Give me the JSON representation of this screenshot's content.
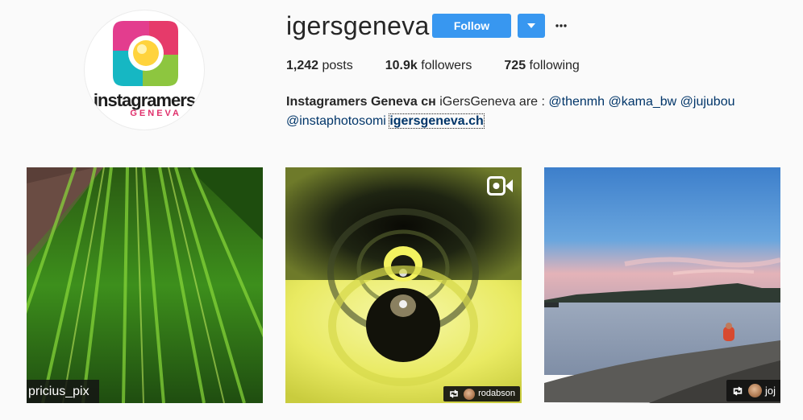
{
  "profile": {
    "username": "igersgeneva",
    "follow_label": "Follow",
    "more_icon": "more-options-icon",
    "logo": {
      "text": "instagramers",
      "subtext": "GENEVA"
    },
    "stats": {
      "posts_count": "1,242",
      "posts_label": "posts",
      "followers_count": "10.9k",
      "followers_label": "followers",
      "following_count": "725",
      "following_label": "following"
    },
    "bio": {
      "name": "Instagramers Geneva ᴄʜ",
      "text": "iGersGeneva are :",
      "mentions": [
        "@thenmh",
        "@kama_bw",
        "@jujubou",
        "@instaphotosomi"
      ],
      "link": "igersgeneva.ch"
    }
  },
  "posts": [
    {
      "caption": "pricius_pix",
      "type": "photo"
    },
    {
      "caption": "rodabson",
      "type": "video",
      "icon": "video-camera-icon",
      "repost_icon": "repost-icon"
    },
    {
      "caption": "joj",
      "type": "photo",
      "repost_icon": "repost-icon"
    }
  ],
  "colors": {
    "accent": "#3897f0",
    "link": "#003569",
    "background": "#fafafa"
  }
}
